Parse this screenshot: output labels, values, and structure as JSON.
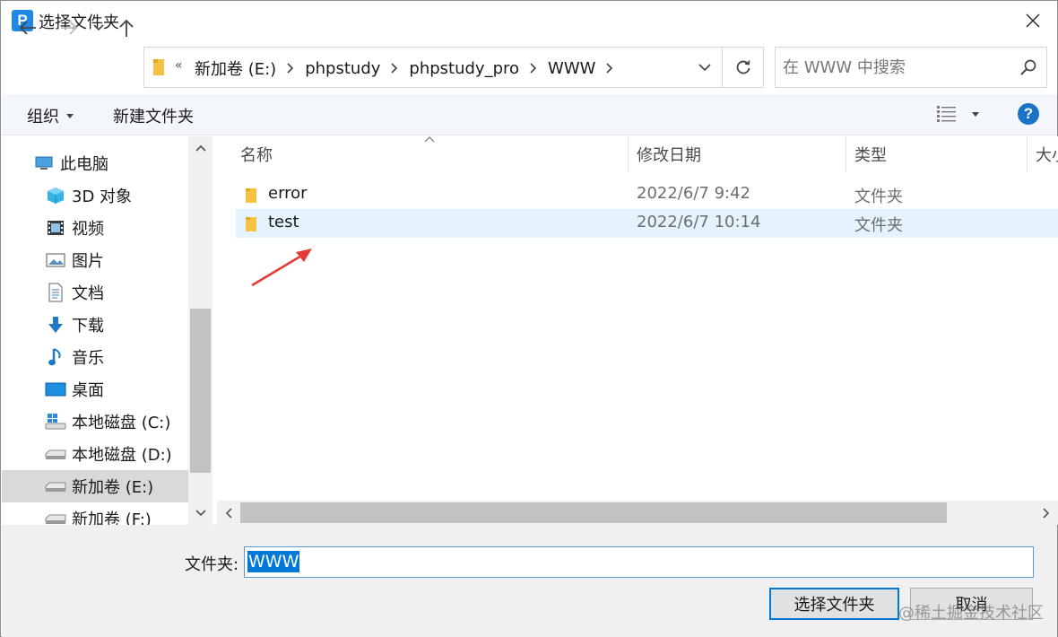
{
  "window": {
    "title": "选择文件夹",
    "app_icon_letter": "P"
  },
  "address": {
    "overflow_marker": "«",
    "crumbs": [
      "新加卷 (E:)",
      "phpstudy",
      "phpstudy_pro",
      "WWW"
    ]
  },
  "search": {
    "placeholder": "在 WWW 中搜索"
  },
  "toolbar": {
    "organize": "组织",
    "new_folder": "新建文件夹",
    "help": "?"
  },
  "nav": {
    "items": [
      {
        "label": "此电脑",
        "icon": "computer-icon"
      },
      {
        "label": "3D 对象",
        "icon": "cube-3d-icon"
      },
      {
        "label": "视频",
        "icon": "video-icon"
      },
      {
        "label": "图片",
        "icon": "picture-icon"
      },
      {
        "label": "文档",
        "icon": "document-icon"
      },
      {
        "label": "下载",
        "icon": "download-arrow-icon"
      },
      {
        "label": "音乐",
        "icon": "music-note-icon"
      },
      {
        "label": "桌面",
        "icon": "desktop-icon"
      },
      {
        "label": "本地磁盘 (C:)",
        "icon": "windows-drive-icon"
      },
      {
        "label": "本地磁盘 (D:)",
        "icon": "drive-icon"
      },
      {
        "label": "新加卷 (E:)",
        "icon": "drive-icon",
        "selected": true
      },
      {
        "label": "新加卷 (F:)",
        "icon": "drive-icon"
      }
    ]
  },
  "list": {
    "columns": {
      "name": "名称",
      "modified": "修改日期",
      "type": "类型",
      "size": "大小"
    },
    "rows": [
      {
        "name": "error",
        "modified": "2022/6/7 9:42",
        "type": "文件夹"
      },
      {
        "name": "test",
        "modified": "2022/6/7 10:14",
        "type": "文件夹",
        "selected": true
      }
    ]
  },
  "footer": {
    "folder_label": "文件夹:",
    "folder_value": "WWW",
    "select_button": "选择文件夹",
    "cancel_button": "取消"
  },
  "watermark": "@稀土掘金技术社区",
  "colors": {
    "accent": "#0078d7",
    "selection": "#e5f3ff",
    "annotation_arrow": "#e53935"
  }
}
